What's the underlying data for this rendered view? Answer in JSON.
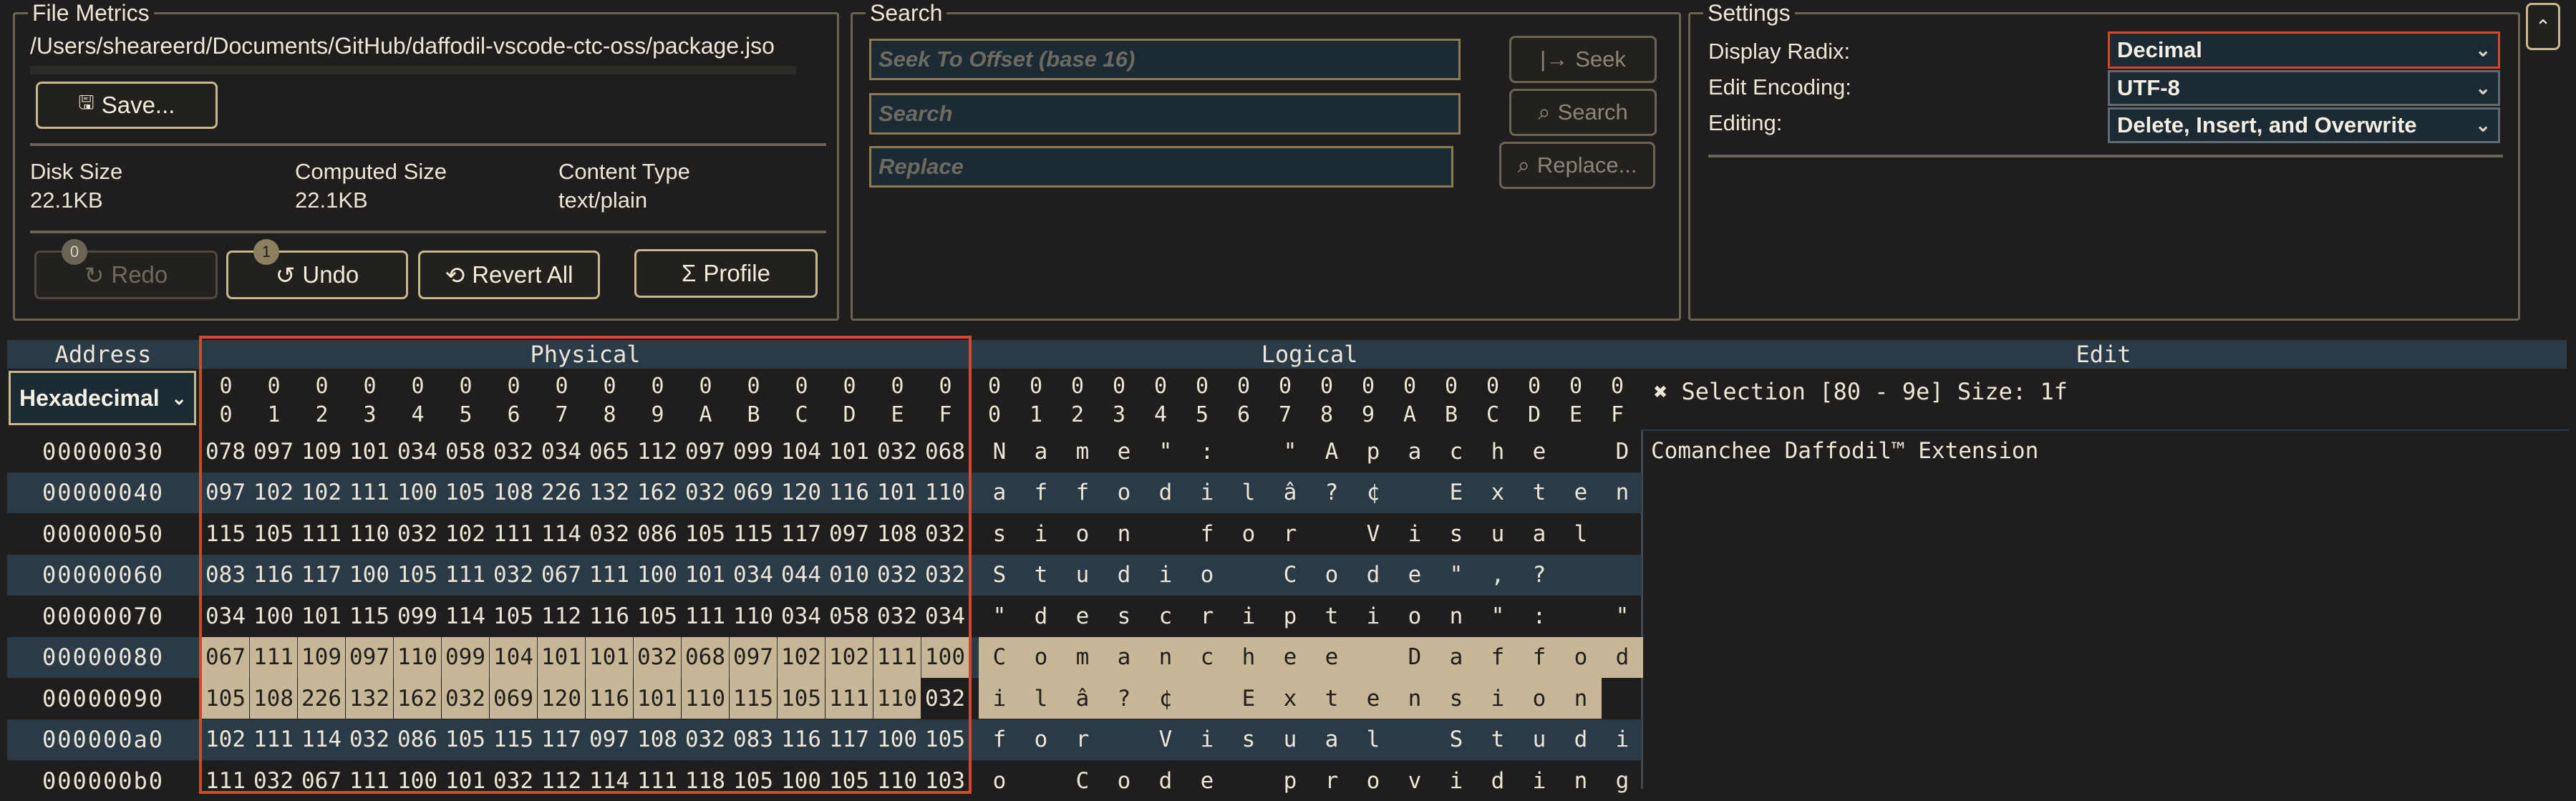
{
  "file_metrics": {
    "legend": "File Metrics",
    "path": "/Users/sheareerd/Documents/GitHub/daffodil-vscode-ctc-oss/package.jso",
    "save_label": "Save...",
    "disk_size_label": "Disk Size",
    "disk_size_value": "22.1KB",
    "computed_size_label": "Computed Size",
    "computed_size_value": "22.1KB",
    "content_type_label": "Content Type",
    "content_type_value": "text/plain",
    "redo_label": "Redo",
    "redo_count": "0",
    "undo_label": "Undo",
    "undo_count": "1",
    "revert_label": "Revert All",
    "profile_label": "Profile"
  },
  "search": {
    "legend": "Search",
    "seek_placeholder": "Seek To Offset (base 16)",
    "search_placeholder": "Search",
    "replace_placeholder": "Replace",
    "seek_label": "Seek",
    "search_label": "Search",
    "replace_label": "Replace..."
  },
  "settings": {
    "legend": "Settings",
    "display_radix_label": "Display Radix:",
    "display_radix_value": "Decimal",
    "edit_encoding_label": "Edit Encoding:",
    "edit_encoding_value": "UTF-8",
    "editing_label": "Editing:",
    "editing_value": "Delete, Insert, and Overwrite",
    "collapse_icon": "chevron-up-icon"
  },
  "viewer": {
    "address_header": "Address",
    "physical_header": "Physical",
    "logical_header": "Logical",
    "edit_header": "Edit",
    "address_radix": "Hexadecimal",
    "selection_text": "✖ Selection [80 - 9e] Size: 1f",
    "edit_content": "Comanchee Daffodil™ Extension",
    "col_top": [
      "0",
      "0",
      "0",
      "0",
      "0",
      "0",
      "0",
      "0",
      "0",
      "0",
      "0",
      "0",
      "0",
      "0",
      "0",
      "0"
    ],
    "col_bottom": [
      "0",
      "1",
      "2",
      "3",
      "4",
      "5",
      "6",
      "7",
      "8",
      "9",
      "A",
      "B",
      "C",
      "D",
      "E",
      "F"
    ],
    "rows": [
      {
        "addr": "00000030",
        "bytes": [
          "078",
          "097",
          "109",
          "101",
          "034",
          "058",
          "032",
          "034",
          "065",
          "112",
          "097",
          "099",
          "104",
          "101",
          "032",
          "068"
        ],
        "chars": [
          "N",
          "a",
          "m",
          "e",
          "\"",
          ":",
          " ",
          "\"",
          "A",
          "p",
          "a",
          "c",
          "h",
          "e",
          " ",
          "D"
        ]
      },
      {
        "addr": "00000040",
        "bytes": [
          "097",
          "102",
          "102",
          "111",
          "100",
          "105",
          "108",
          "226",
          "132",
          "162",
          "032",
          "069",
          "120",
          "116",
          "101",
          "110"
        ],
        "chars": [
          "a",
          "f",
          "f",
          "o",
          "d",
          "i",
          "l",
          "â",
          "?",
          "¢",
          " ",
          "E",
          "x",
          "t",
          "e",
          "n"
        ]
      },
      {
        "addr": "00000050",
        "bytes": [
          "115",
          "105",
          "111",
          "110",
          "032",
          "102",
          "111",
          "114",
          "032",
          "086",
          "105",
          "115",
          "117",
          "097",
          "108",
          "032"
        ],
        "chars": [
          "s",
          "i",
          "o",
          "n",
          " ",
          "f",
          "o",
          "r",
          " ",
          "V",
          "i",
          "s",
          "u",
          "a",
          "l",
          " "
        ]
      },
      {
        "addr": "00000060",
        "bytes": [
          "083",
          "116",
          "117",
          "100",
          "105",
          "111",
          "032",
          "067",
          "111",
          "100",
          "101",
          "034",
          "044",
          "010",
          "032",
          "032"
        ],
        "chars": [
          "S",
          "t",
          "u",
          "d",
          "i",
          "o",
          " ",
          "C",
          "o",
          "d",
          "e",
          "\"",
          ",",
          "?",
          " ",
          " "
        ]
      },
      {
        "addr": "00000070",
        "bytes": [
          "034",
          "100",
          "101",
          "115",
          "099",
          "114",
          "105",
          "112",
          "116",
          "105",
          "111",
          "110",
          "034",
          "058",
          "032",
          "034"
        ],
        "chars": [
          "\"",
          "d",
          "e",
          "s",
          "c",
          "r",
          "i",
          "p",
          "t",
          "i",
          "o",
          "n",
          "\"",
          ":",
          " ",
          "\""
        ]
      },
      {
        "addr": "00000080",
        "bytes": [
          "067",
          "111",
          "109",
          "097",
          "110",
          "099",
          "104",
          "101",
          "101",
          "032",
          "068",
          "097",
          "102",
          "102",
          "111",
          "100"
        ],
        "chars": [
          "C",
          "o",
          "m",
          "a",
          "n",
          "c",
          "h",
          "e",
          "e",
          " ",
          "D",
          "a",
          "f",
          "f",
          "o",
          "d"
        ]
      },
      {
        "addr": "00000090",
        "bytes": [
          "105",
          "108",
          "226",
          "132",
          "162",
          "032",
          "069",
          "120",
          "116",
          "101",
          "110",
          "115",
          "105",
          "111",
          "110",
          "032"
        ],
        "chars": [
          "i",
          "l",
          "â",
          "?",
          "¢",
          " ",
          "E",
          "x",
          "t",
          "e",
          "n",
          "s",
          "i",
          "o",
          "n",
          " "
        ]
      },
      {
        "addr": "000000a0",
        "bytes": [
          "102",
          "111",
          "114",
          "032",
          "086",
          "105",
          "115",
          "117",
          "097",
          "108",
          "032",
          "083",
          "116",
          "117",
          "100",
          "105"
        ],
        "chars": [
          "f",
          "o",
          "r",
          " ",
          "V",
          "i",
          "s",
          "u",
          "a",
          "l",
          " ",
          "S",
          "t",
          "u",
          "d",
          "i"
        ]
      },
      {
        "addr": "000000b0",
        "bytes": [
          "111",
          "032",
          "067",
          "111",
          "100",
          "101",
          "032",
          "112",
          "114",
          "111",
          "118",
          "105",
          "100",
          "105",
          "110",
          "103"
        ],
        "chars": [
          "o",
          " ",
          "C",
          "o",
          "d",
          "e",
          " ",
          "p",
          "r",
          "o",
          "v",
          "i",
          "d",
          "i",
          "n",
          "g"
        ]
      }
    ]
  }
}
